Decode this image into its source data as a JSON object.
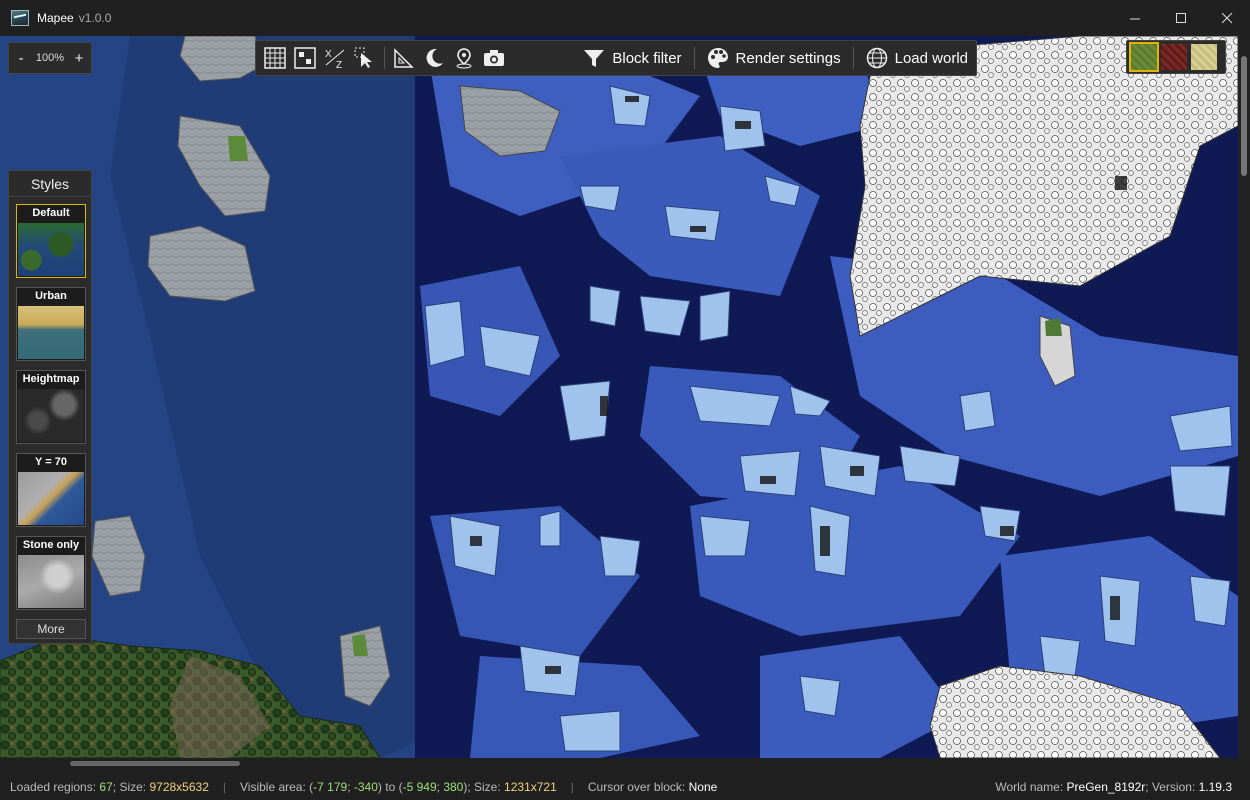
{
  "window": {
    "title": "Mapee",
    "version": "v1.0.0",
    "controls": {
      "minimize": "—",
      "maximize": "☐",
      "close": "✕"
    }
  },
  "zoom": {
    "minus": "-",
    "value": "100%",
    "plus": "+"
  },
  "toolbar": {
    "icons": [
      "grid-icon",
      "chunk-icon",
      "coordinates-icon",
      "select-cursor-icon",
      "ruler-icon",
      "night-mode-icon",
      "marker-icon",
      "screenshot-icon"
    ],
    "block_filter": "Block filter",
    "render_settings": "Render settings",
    "load_world": "Load world"
  },
  "swatches": [
    {
      "name": "grass-block",
      "color": "#6b8a3a",
      "selected": true
    },
    {
      "name": "netherrack",
      "color": "#7a2a26",
      "selected": false
    },
    {
      "name": "sand",
      "color": "#d8cf92",
      "selected": false
    }
  ],
  "styles": {
    "title": "Styles",
    "items": [
      {
        "label": "Default",
        "active": true
      },
      {
        "label": "Urban",
        "active": false
      },
      {
        "label": "Heightmap",
        "active": false
      },
      {
        "label": "Y = 70",
        "active": false
      },
      {
        "label": "Stone only",
        "active": false
      }
    ],
    "more": "More"
  },
  "status": {
    "loaded_label": "Loaded regions:",
    "loaded_value": "67",
    "size_label": "; Size:",
    "size_value": "9728x5632",
    "visible_label": "Visible area:",
    "visible_from_open": "(",
    "visible_from_x": "-7 179",
    "visible_from_sep": ";",
    "visible_from_y": "-340",
    "visible_to_label": ") to (",
    "visible_to_x": "-5 949",
    "visible_to_y": "380",
    "visible_close": ")",
    "visible_size_label": "; Size:",
    "visible_size_value": "1231x721",
    "cursor_label": "Cursor over block:",
    "cursor_value": "None",
    "world_label": "World name:",
    "world_value": "PreGen_8192r",
    "version_label": "; Version:",
    "version_value": "1.19.3"
  }
}
